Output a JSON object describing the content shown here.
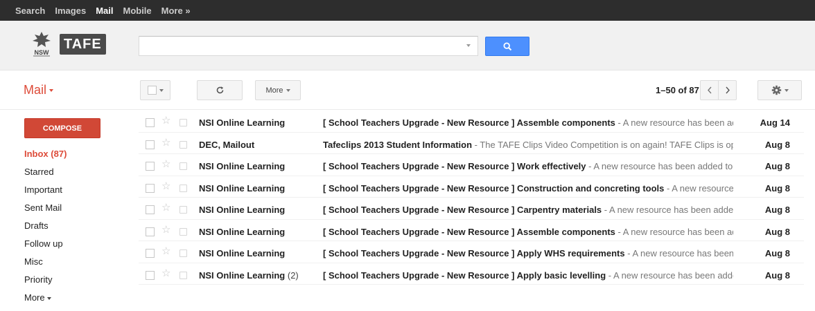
{
  "topnav": {
    "items": [
      "Search",
      "Images",
      "Mail",
      "Mobile",
      "More »"
    ],
    "active": "Mail"
  },
  "header": {
    "logo_text": "TAFE",
    "logo_sub": "NSW",
    "search_placeholder": ""
  },
  "toolbar": {
    "mail_label": "Mail",
    "more_label": "More",
    "pager": "1–50 of 87"
  },
  "sidebar": {
    "compose_label": "COMPOSE",
    "labels": [
      "Inbox (87)",
      "Starred",
      "Important",
      "Sent Mail",
      "Drafts",
      "Follow up",
      "Misc",
      "Priority",
      "More"
    ]
  },
  "emails": [
    {
      "sender": "NSI Online Learning",
      "count": "",
      "subject": "[ School Teachers Upgrade - New Resource ] Assemble components",
      "snippet": " - A new resource has been added to the",
      "date": "Aug 14"
    },
    {
      "sender": "DEC, Mailout",
      "count": "",
      "subject": "Tafeclips 2013 Student Information",
      "snippet": " - The TAFE Clips Video Competition is on again! TAFE Clips is open to all",
      "date": "Aug 8"
    },
    {
      "sender": "NSI Online Learning",
      "count": "",
      "subject": "[ School Teachers Upgrade - New Resource ] Work effectively",
      "snippet": " - A new resource has been added to the \"School",
      "date": "Aug 8"
    },
    {
      "sender": "NSI Online Learning",
      "count": "",
      "subject": "[ School Teachers Upgrade - New Resource ] Construction and concreting tools",
      "snippet": " - A new resource has been",
      "date": "Aug 8"
    },
    {
      "sender": "NSI Online Learning",
      "count": "",
      "subject": "[ School Teachers Upgrade - New Resource ] Carpentry materials",
      "snippet": " - A new resource has been added to the",
      "date": "Aug 8"
    },
    {
      "sender": "NSI Online Learning",
      "count": "",
      "subject": "[ School Teachers Upgrade - New Resource ] Assemble components",
      "snippet": " - A new resource has been added to the",
      "date": "Aug 8"
    },
    {
      "sender": "NSI Online Learning",
      "count": "",
      "subject": "[ School Teachers Upgrade - New Resource ] Apply WHS requirements",
      "snippet": " - A new resource has been added",
      "date": "Aug 8"
    },
    {
      "sender": "NSI Online Learning",
      "count": "(2)",
      "subject": "[ School Teachers Upgrade - New Resource ] Apply basic levelling",
      "snippet": " - A new resource has been added to the",
      "date": "Aug 8"
    }
  ],
  "colors": {
    "brand_red": "#dd4b39",
    "compose_red": "#d14836",
    "search_blue": "#4d90fe",
    "topbar": "#2d2d2d"
  }
}
